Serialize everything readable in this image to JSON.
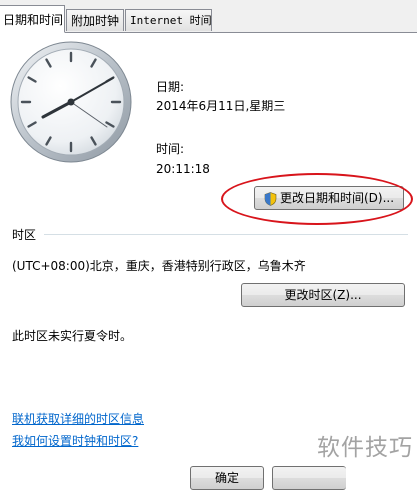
{
  "tabs": [
    {
      "label": "日期和时间"
    },
    {
      "label": "附加时钟"
    },
    {
      "label": "Internet 时间"
    }
  ],
  "date_label": "日期:",
  "date_value": "2014年6月11日,星期三",
  "time_label": "时间:",
  "time_value": "20:11:18",
  "change_datetime_button": "更改日期和时间(D)...",
  "timezone_header": "时区",
  "timezone_value": "(UTC+08:00)北京，重庆，香港特别行政区，乌鲁木齐",
  "change_timezone_button": "更改时区(Z)...",
  "dst_note": "此时区未实行夏令时。",
  "links": {
    "timezone_info": "联机获取详细的时区信息",
    "how_to_set": "我如何设置时钟和时区?"
  },
  "ok_button": "确定",
  "watermark": "软件技巧",
  "colors": {
    "link": "#0066cc",
    "annotation_circle": "#d8141b"
  },
  "icons": [
    "analog-clock-icon",
    "uac-shield-icon"
  ]
}
